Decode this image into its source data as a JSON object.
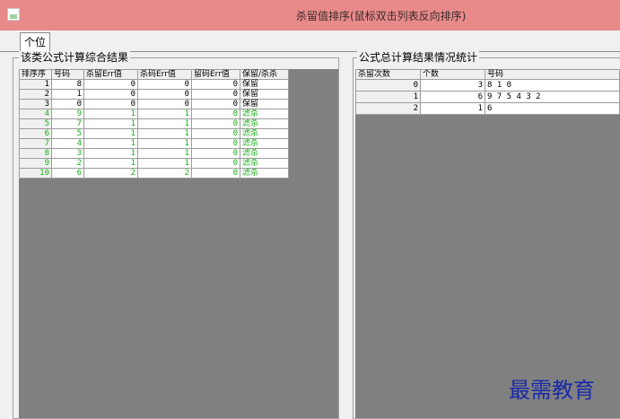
{
  "window": {
    "title": "杀留值排序(鼠标双击列表反向排序)",
    "icon": "app-icon"
  },
  "tabs": [
    {
      "label": "个位",
      "selected": true
    }
  ],
  "left_panel": {
    "legend": "该类公式计算综合结果",
    "columns": [
      "排序序",
      "号码",
      "杀留Err值",
      "杀码Err值",
      "留码Err值",
      "保留/杀杀"
    ],
    "rows": [
      {
        "rank": "1",
        "num": "8",
        "kill_keep_err": "0",
        "kill_err": "0",
        "keep_err": "0",
        "status": "保留",
        "highlight": false
      },
      {
        "rank": "2",
        "num": "1",
        "kill_keep_err": "0",
        "kill_err": "0",
        "keep_err": "0",
        "status": "保留",
        "highlight": false
      },
      {
        "rank": "3",
        "num": "0",
        "kill_keep_err": "0",
        "kill_err": "0",
        "keep_err": "0",
        "status": "保留",
        "highlight": false
      },
      {
        "rank": "4",
        "num": "9",
        "kill_keep_err": "1",
        "kill_err": "1",
        "keep_err": "0",
        "status": "滤杀",
        "highlight": true
      },
      {
        "rank": "5",
        "num": "7",
        "kill_keep_err": "1",
        "kill_err": "1",
        "keep_err": "0",
        "status": "滤杀",
        "highlight": true
      },
      {
        "rank": "6",
        "num": "5",
        "kill_keep_err": "1",
        "kill_err": "1",
        "keep_err": "0",
        "status": "滤杀",
        "highlight": true
      },
      {
        "rank": "7",
        "num": "4",
        "kill_keep_err": "1",
        "kill_err": "1",
        "keep_err": "0",
        "status": "滤杀",
        "highlight": true
      },
      {
        "rank": "8",
        "num": "3",
        "kill_keep_err": "1",
        "kill_err": "1",
        "keep_err": "0",
        "status": "滤杀",
        "highlight": true
      },
      {
        "rank": "9",
        "num": "2",
        "kill_keep_err": "1",
        "kill_err": "1",
        "keep_err": "0",
        "status": "滤杀",
        "highlight": true
      },
      {
        "rank": "10",
        "num": "6",
        "kill_keep_err": "2",
        "kill_err": "2",
        "keep_err": "0",
        "status": "滤杀",
        "highlight": true
      }
    ]
  },
  "right_panel": {
    "legend": "公式总计算结果情况统计",
    "columns": [
      "杀留次数",
      "个数",
      "号码"
    ],
    "rows": [
      {
        "times": "0",
        "count": "3",
        "numbers": "8 1 0"
      },
      {
        "times": "1",
        "count": "6",
        "numbers": "9 7 5 4 3 2"
      },
      {
        "times": "2",
        "count": "1",
        "numbers": "6"
      }
    ]
  },
  "watermark": "最需教育",
  "colors": {
    "titlebar": "#e98a8a",
    "grid_background": "#808080",
    "green_text": "#19b019",
    "watermark": "#1a2aa8"
  }
}
